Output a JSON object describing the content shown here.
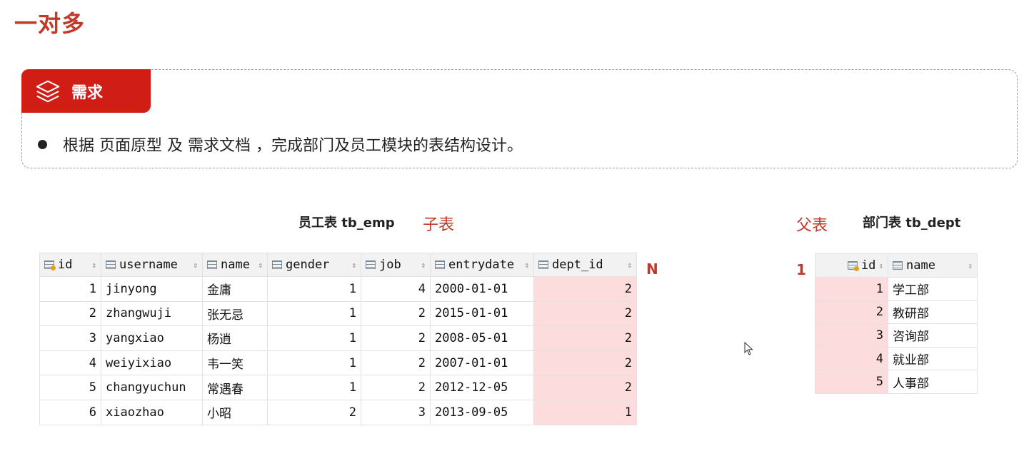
{
  "title": "一对多",
  "requirement": {
    "label": "需求",
    "text": "根据 页面原型 及 需求文档 ，完成部门及员工模块的表结构设计。"
  },
  "emp_table": {
    "caption": "员工表 tb_emp",
    "role": "子表",
    "cardinality": "N",
    "columns": [
      "id",
      "username",
      "name",
      "gender",
      "job",
      "entrydate",
      "dept_id"
    ],
    "rows": [
      [
        "1",
        "jinyong",
        "金庸",
        "1",
        "4",
        "2000-01-01",
        "2"
      ],
      [
        "2",
        "zhangwuji",
        "张无忌",
        "1",
        "2",
        "2015-01-01",
        "2"
      ],
      [
        "3",
        "yangxiao",
        "杨逍",
        "1",
        "2",
        "2008-05-01",
        "2"
      ],
      [
        "4",
        "weiyixiao",
        "韦一笑",
        "1",
        "2",
        "2007-01-01",
        "2"
      ],
      [
        "5",
        "changyuchun",
        "常遇春",
        "1",
        "2",
        "2012-12-05",
        "2"
      ],
      [
        "6",
        "xiaozhao",
        "小昭",
        "2",
        "3",
        "2013-09-05",
        "1"
      ]
    ]
  },
  "dept_table": {
    "caption": "部门表 tb_dept",
    "role": "父表",
    "cardinality": "1",
    "columns": [
      "id",
      "name"
    ],
    "rows": [
      [
        "1",
        "学工部"
      ],
      [
        "2",
        "教研部"
      ],
      [
        "3",
        "咨询部"
      ],
      [
        "4",
        "就业部"
      ],
      [
        "5",
        "人事部"
      ]
    ]
  },
  "colors": {
    "accent": "#d01e17",
    "highlight": "#fcdcdc",
    "title": "#c0392b"
  }
}
